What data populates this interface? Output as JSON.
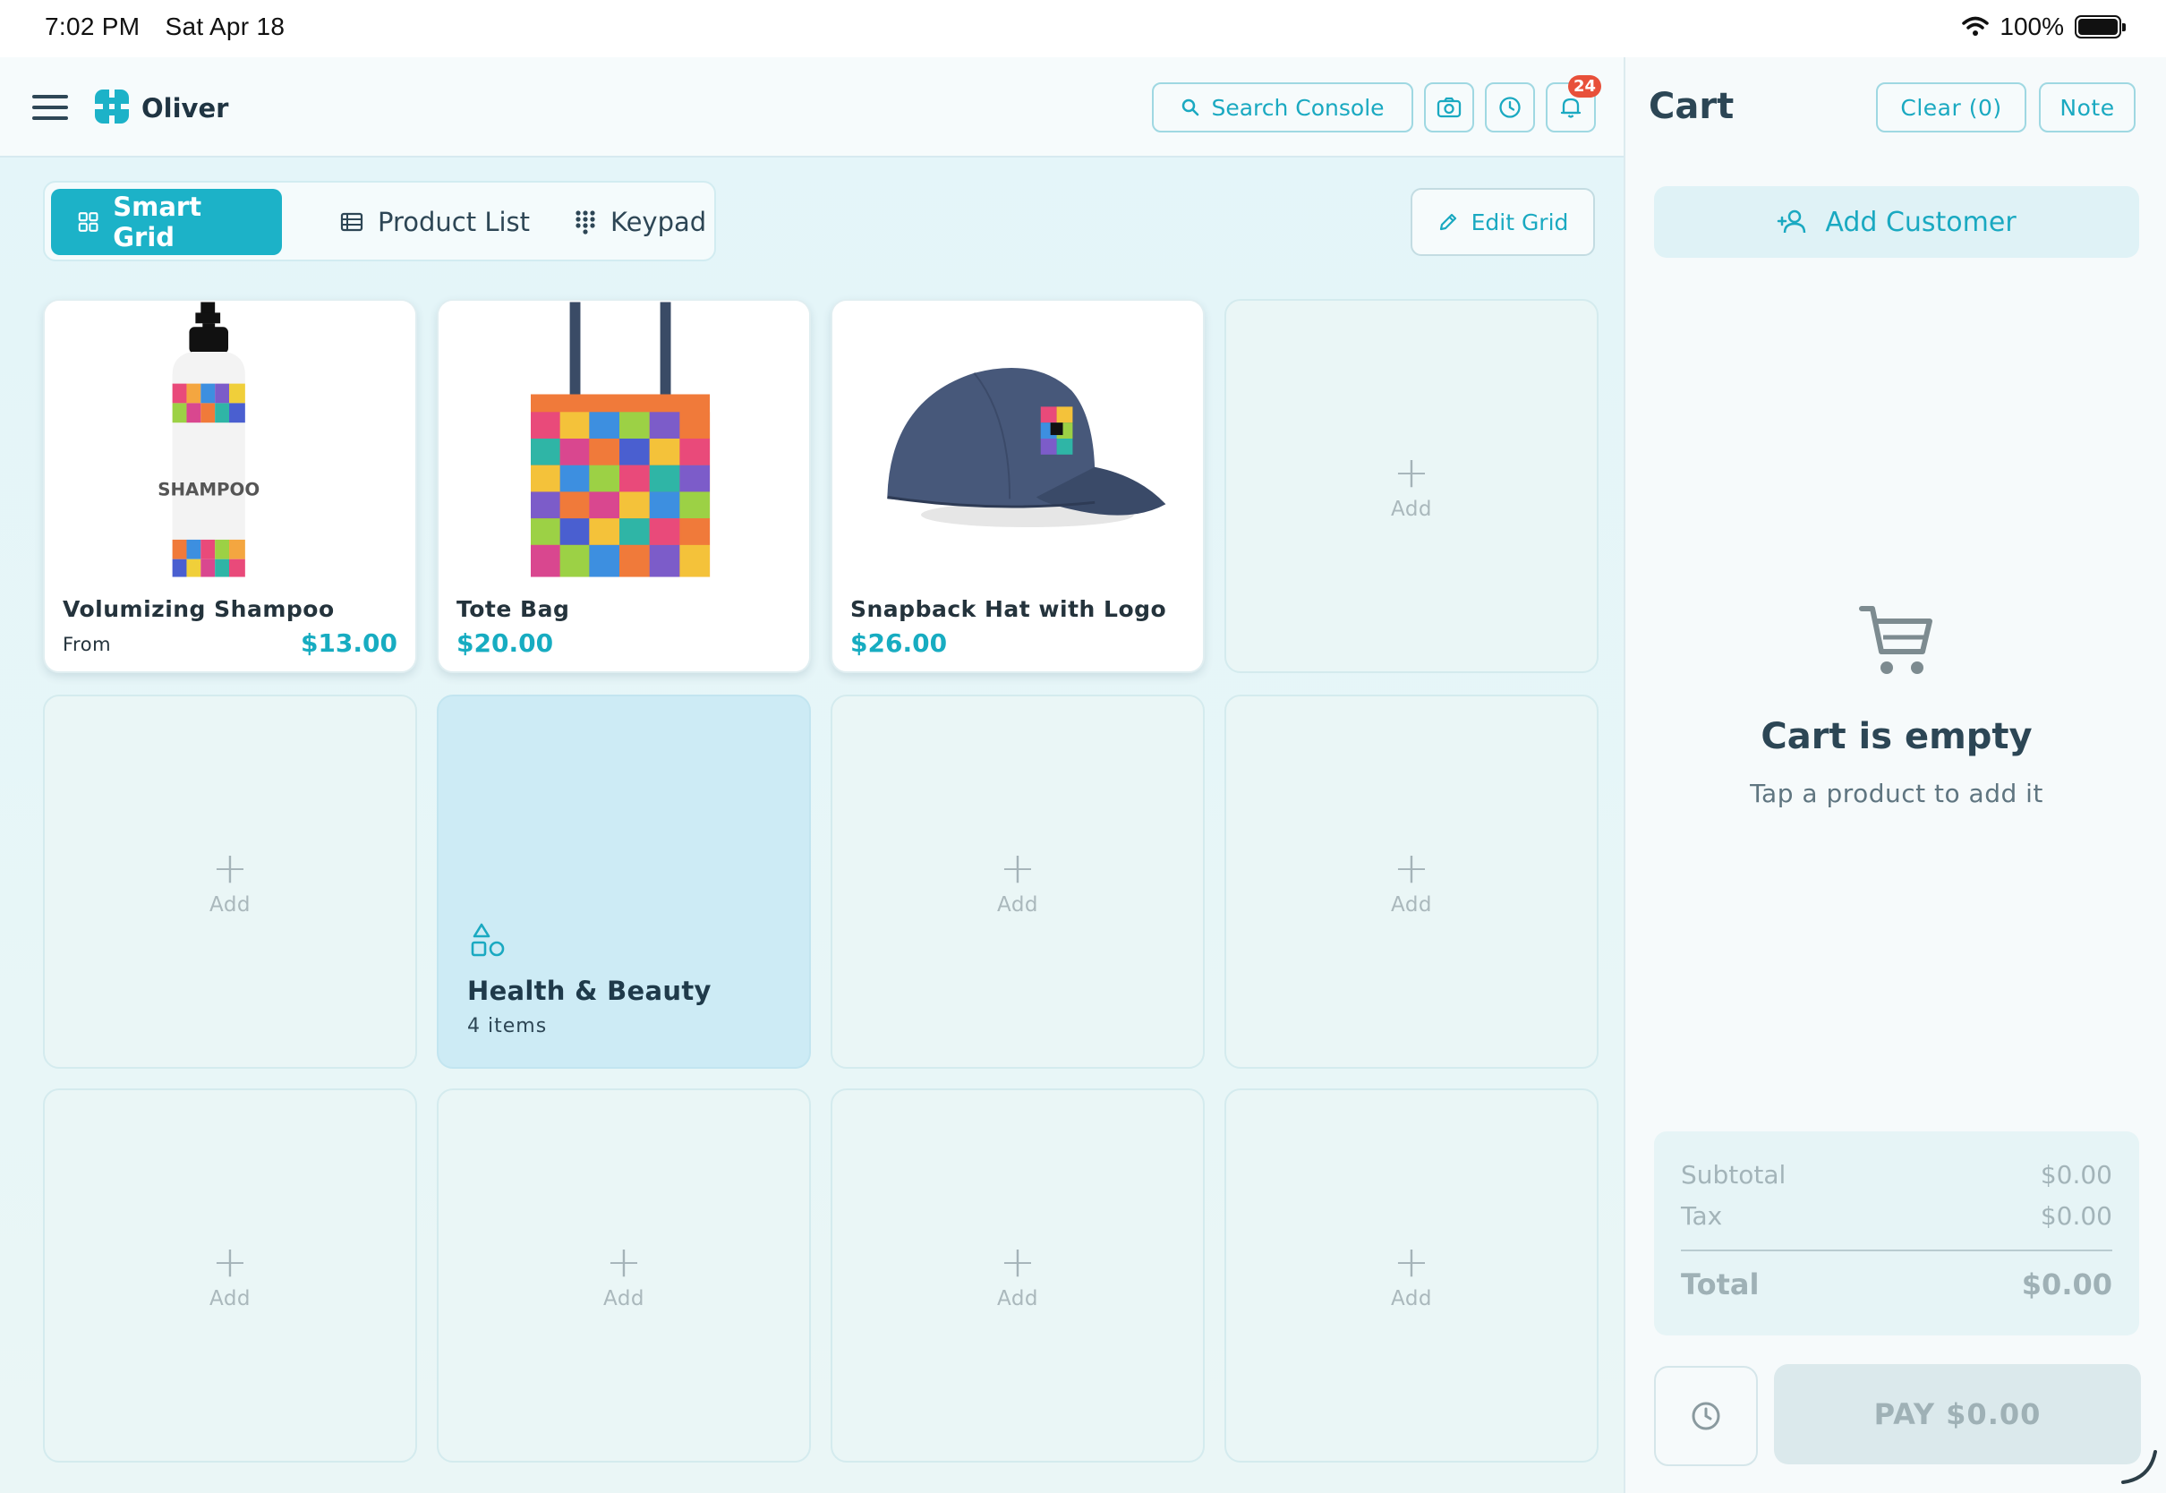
{
  "status_bar": {
    "time": "7:02 PM",
    "date": "Sat Apr 18",
    "battery": "100%"
  },
  "header": {
    "brand": "Oliver",
    "search_label": "Search Console",
    "notifications_count": "24"
  },
  "tabs": [
    {
      "label": "Smart Grid",
      "icon": "grid-icon",
      "active": true
    },
    {
      "label": "Product List",
      "icon": "list-icon",
      "active": false
    },
    {
      "label": "Keypad",
      "icon": "keypad-icon",
      "active": false
    }
  ],
  "edit_grid_label": "Edit Grid",
  "grid": {
    "add_label": "Add",
    "products": [
      {
        "name": "Volumizing Shampoo",
        "prefix": "From",
        "price": "$13.00"
      },
      {
        "name": "Tote Bag",
        "price": "$20.00"
      },
      {
        "name": "Snapback Hat with Logo",
        "price": "$26.00"
      }
    ],
    "category": {
      "name": "Health & Beauty",
      "count": "4 items"
    },
    "shampoo_label": "SHAMPOO"
  },
  "cart": {
    "title": "Cart",
    "clear_label": "Clear (0)",
    "note_label": "Note",
    "add_customer_label": "Add Customer",
    "empty_title": "Cart is empty",
    "empty_subtitle": "Tap a product to add it",
    "subtotal_label": "Subtotal",
    "subtotal_value": "$0.00",
    "tax_label": "Tax",
    "tax_value": "$0.00",
    "total_label": "Total",
    "total_value": "$0.00",
    "pay_label": "PAY $0.00"
  },
  "colors": {
    "accent": "#1cb2c8",
    "badge": "#e8503a",
    "text": "#243b4a"
  }
}
